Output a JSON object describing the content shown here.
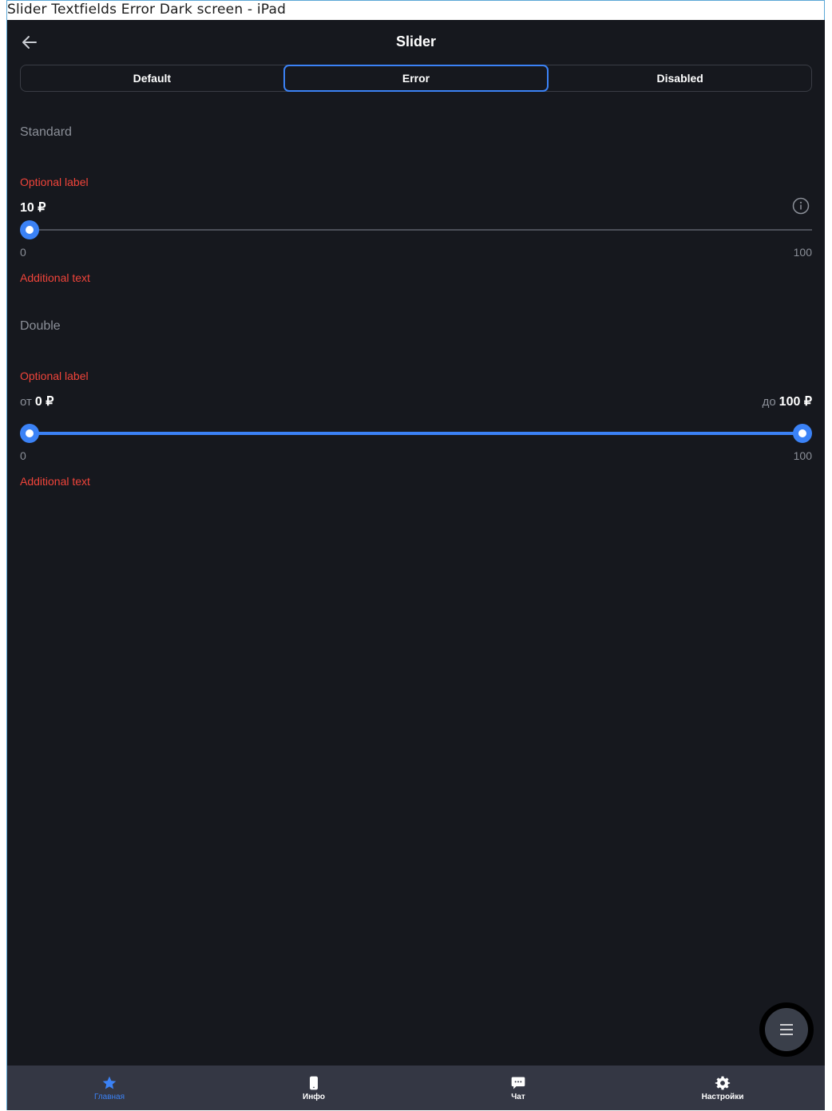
{
  "frame": {
    "title": "Slider Textfields Error Dark screen - iPad"
  },
  "header": {
    "title": "Slider",
    "back_icon": "arrow-left-icon"
  },
  "tabs": [
    {
      "label": "Default",
      "active": false
    },
    {
      "label": "Error",
      "active": true
    },
    {
      "label": "Disabled",
      "active": false
    }
  ],
  "standard": {
    "section_title": "Standard",
    "optional_label": "Optional label",
    "value": "10 ₽",
    "min_label": "0",
    "max_label": "100",
    "additional_text": "Additional text",
    "value_fraction": 0.0
  },
  "double": {
    "section_title": "Double",
    "optional_label": "Optional label",
    "from_prefix": "от",
    "from_value": "0 ₽",
    "to_prefix": "до",
    "to_value": "100 ₽",
    "min_label": "0",
    "max_label": "100",
    "additional_text": "Additional text",
    "low_fraction": 0.0,
    "high_fraction": 1.0
  },
  "bottom_nav": [
    {
      "label": "Главная",
      "icon": "star-icon",
      "active": true
    },
    {
      "label": "Инфо",
      "icon": "phone-icon",
      "active": false
    },
    {
      "label": "Чат",
      "icon": "chat-icon",
      "active": false
    },
    {
      "label": "Настройки",
      "icon": "gear-icon",
      "active": false
    }
  ],
  "colors": {
    "accent": "#3b82f6",
    "error": "#f0443a",
    "background": "#16181e",
    "nav_background": "#343744"
  }
}
